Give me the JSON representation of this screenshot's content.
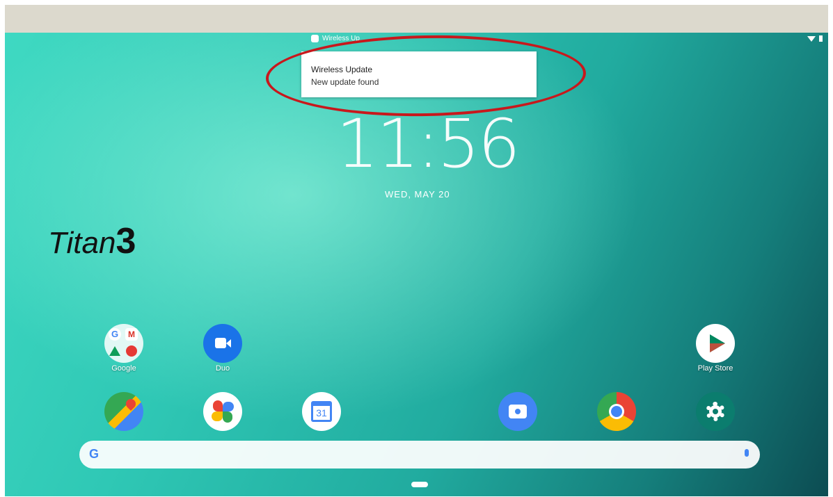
{
  "status_bar": {
    "mini_notification": "Wireless Up"
  },
  "notification": {
    "title": "Wireless Update",
    "body": "New update found"
  },
  "clock": {
    "time": "11:56",
    "date": "WED, MAY 20"
  },
  "brand": {
    "name": "Titan",
    "number": "3"
  },
  "apps_row1": [
    {
      "label": "Google"
    },
    {
      "label": "Duo"
    },
    {
      "label": "Play Store"
    }
  ],
  "dock": [
    "maps-icon",
    "photos-icon",
    "calendar-icon",
    "camera-icon",
    "chrome-icon",
    "settings-icon"
  ],
  "calendar_day": "31",
  "search": {
    "logo": "G"
  },
  "colors": {
    "accent_red_circle": "#c8181c",
    "google_blue": "#4285f4"
  }
}
